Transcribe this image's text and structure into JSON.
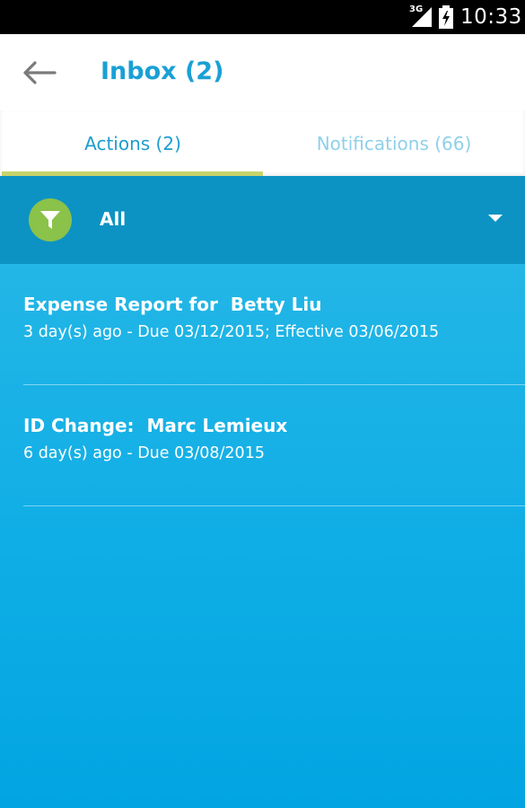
{
  "status_bar": {
    "network": "3G",
    "time": "10:33"
  },
  "header": {
    "title": "Inbox (2)"
  },
  "tabs": [
    {
      "label": "Actions (2)",
      "selected": true
    },
    {
      "label": "Notifications (66)",
      "selected": false
    }
  ],
  "filter": {
    "selected": "All"
  },
  "items": [
    {
      "title": "Expense Report for  Betty Liu",
      "subtitle": "3 day(s) ago - Due 03/12/2015; Effective 03/06/2015"
    },
    {
      "title": "ID Change:  Marc Lemieux",
      "subtitle": "6 day(s) ago - Due 03/08/2015"
    }
  ],
  "colors": {
    "accent": "#1aa0d6",
    "tab_indicator": "#c7d36a",
    "filter_bar": "#0c93c4",
    "filter_icon": "#8ac24a",
    "list_background": "#10aee6"
  },
  "icons": {
    "back": "arrow-left-icon",
    "filter": "funnel-icon",
    "dropdown": "caret-down-icon",
    "signal": "cell-signal-icon",
    "battery": "battery-charging-icon"
  }
}
